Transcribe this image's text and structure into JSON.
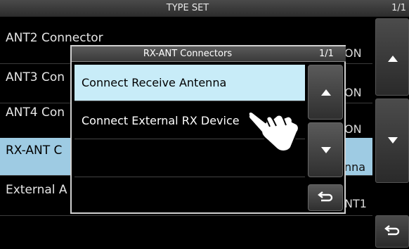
{
  "screen": {
    "title": "TYPE SET",
    "page_indicator": "1/1",
    "rows": [
      {
        "label": "ANT2 Connector",
        "value": "ON"
      },
      {
        "label": "ANT3 Con",
        "value": "ON"
      },
      {
        "label": "ANT4 Con",
        "value": "ON"
      },
      {
        "label": "RX-ANT C",
        "value": "nna"
      },
      {
        "label": "External A",
        "value": "NT1"
      }
    ],
    "selected_row": 3
  },
  "dialog": {
    "title": "RX-ANT Connectors",
    "page_indicator": "1/1",
    "options": [
      {
        "label": "Connect Receive Antenna",
        "selected": true
      },
      {
        "label": "Connect External RX Device",
        "selected": false
      },
      {
        "label": "",
        "selected": false
      },
      {
        "label": "",
        "selected": false
      }
    ]
  },
  "icons": {
    "up": "triangle-up",
    "down": "triangle-down",
    "back": "return-arrow",
    "touch": "pointing-hand"
  },
  "colors": {
    "selected_row": "#9ecbe3",
    "selected_option": "#c8ecf8",
    "background": "#000000"
  }
}
